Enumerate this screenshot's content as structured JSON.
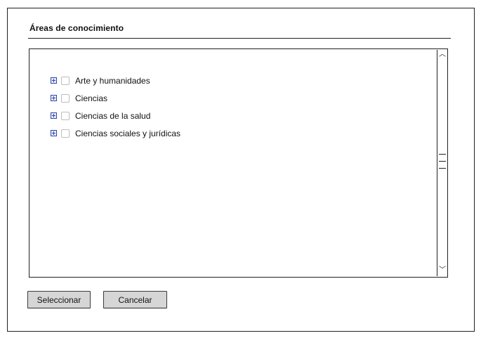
{
  "dialog": {
    "title": "Áreas de conocimiento"
  },
  "tree": {
    "items": [
      {
        "label": "Arte y humanidades",
        "icon": "plus-expand-icon"
      },
      {
        "label": "Ciencias",
        "icon": "plus-expand-icon"
      },
      {
        "label": "Ciencias de la salud",
        "icon": "plus-expand-icon"
      },
      {
        "label": "Ciencias sociales y jurídicas",
        "icon": "plus-expand-icon"
      }
    ],
    "scrollbar": {
      "up_icon": "chevron-up-icon",
      "down_icon": "chevron-down-icon",
      "grip_icon": "scroll-grip-icon"
    }
  },
  "buttons": {
    "select_label": "Seleccionar",
    "cancel_label": "Cancelar"
  },
  "colors": {
    "border": "#202020",
    "button_bg": "#d6d6d6",
    "expand_icon": "#2e46a8",
    "checkbox_border": "#bdbdbd"
  }
}
